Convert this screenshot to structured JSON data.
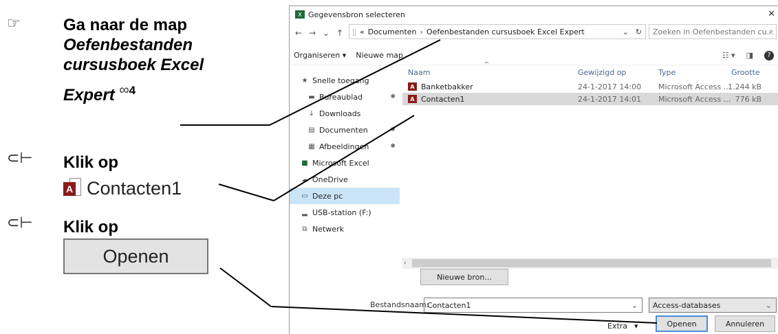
{
  "instructions": {
    "step1": {
      "line1": "Ga naar de map",
      "line2": "Oefenbestanden",
      "line3": "cursusboek Excel",
      "line4": "Expert",
      "badge": "4"
    },
    "step2": {
      "label": "Klik op",
      "file_name": "Contacten1"
    },
    "step3": {
      "label": "Klik op",
      "button": "Openen"
    }
  },
  "dialog": {
    "title": "Gegevensbron selecteren",
    "path_prefix": "«",
    "path_part1": "Documenten",
    "path_part2": "Oefenbestanden cursusboek Excel Expert",
    "search_placeholder": "Zoeken in Oefenbestanden cu...",
    "toolbar": {
      "organize": "Organiseren ▾",
      "new_folder": "Nieuwe map"
    },
    "nav": [
      {
        "label": "Snelle toegang"
      },
      {
        "label": "Bureaublad"
      },
      {
        "label": "Downloads"
      },
      {
        "label": "Documenten"
      },
      {
        "label": "Afbeeldingen"
      },
      {
        "label": "Microsoft Excel"
      },
      {
        "label": "OneDrive"
      },
      {
        "label": "Deze pc"
      },
      {
        "label": "USB-station (F:)"
      },
      {
        "label": "Netwerk"
      }
    ],
    "columns": {
      "name": "Naam",
      "date": "Gewijzigd op",
      "type": "Type",
      "size": "Grootte"
    },
    "files": [
      {
        "name": "Banketbakker",
        "date": "24-1-2017 14:00",
        "type": "Microsoft Access ...",
        "size": "1.244 kB"
      },
      {
        "name": "Contacten1",
        "date": "24-1-2017 14:01",
        "type": "Microsoft Access ...",
        "size": "776 kB"
      }
    ],
    "new_source": "Nieuwe bron...",
    "filename_label": "Bestandsnaam:",
    "filename_value": "Contacten1",
    "filter": "Access-databases",
    "extra": "Extra",
    "open": "Openen",
    "cancel": "Annuleren"
  }
}
